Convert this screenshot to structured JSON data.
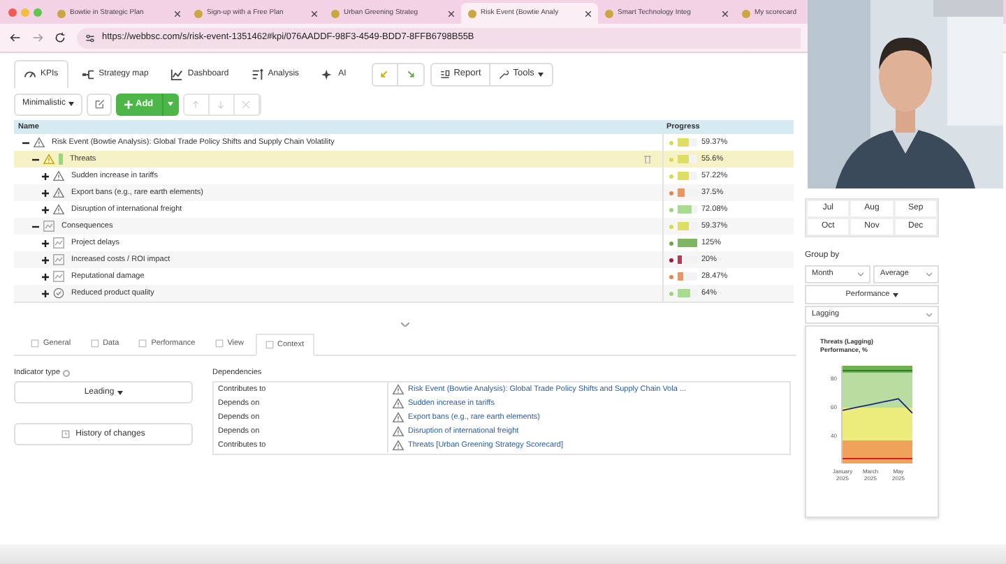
{
  "browser": {
    "tabs": [
      {
        "title": "Bowtie in Strategic Plan",
        "selected": false
      },
      {
        "title": "Sign-up with a Free Plan",
        "selected": false
      },
      {
        "title": "Urban Greening Strateg",
        "selected": false
      },
      {
        "title": "Risk Event (Bowtie Analy",
        "selected": true
      },
      {
        "title": "Smart Technology Integ",
        "selected": false
      },
      {
        "title": "My scorecard",
        "selected": false
      }
    ],
    "url": "https://webbsc.com/s/risk-event-1351462#kpi/076AADDF-98F3-4549-BDD7-8FFB6798B55B"
  },
  "toolbar": {
    "tabs": [
      {
        "label": "KPIs",
        "kind": "kpis",
        "selected": true
      },
      {
        "label": "Strategy map",
        "kind": "map",
        "selected": false
      },
      {
        "label": "Dashboard",
        "kind": "dashboard",
        "selected": false
      },
      {
        "label": "Analysis",
        "kind": "analysis",
        "selected": false
      },
      {
        "label": "AI",
        "kind": "ai",
        "selected": false
      }
    ],
    "report": "Report",
    "tools": "Tools"
  },
  "subtoolbar": {
    "view": "Minimalistic",
    "add": "Add"
  },
  "table": {
    "columns": [
      "Name",
      "Progress"
    ],
    "rows": [
      {
        "name": "Risk Event (Bowtie Analysis): Global Trade Policy Shifts and Supply Chain Volatility",
        "kind": "risk",
        "expanded": true,
        "selected": false,
        "progress": "59.37%",
        "level": 0.59,
        "color": "#d9d94a",
        "children": [
          {
            "name": "Threats",
            "kind": "threats",
            "expanded": true,
            "selected": true,
            "progress": "55.6%",
            "level": 0.56,
            "color": "#d9d94a",
            "children": [
              {
                "name": "Sudden increase in tariffs",
                "kind": "risk",
                "expanded": false,
                "selected": false,
                "progress": "57.22%",
                "level": 0.57,
                "color": "#d9d94a"
              },
              {
                "name": "Export bans (e.g., rare earth elements)",
                "kind": "risk",
                "expanded": false,
                "selected": false,
                "progress": "37.5%",
                "level": 0.38,
                "color": "#e8844a"
              },
              {
                "name": "Disruption of international freight",
                "kind": "risk",
                "expanded": false,
                "selected": false,
                "progress": "72.08%",
                "level": 0.72,
                "color": "#9ad67e"
              }
            ]
          },
          {
            "name": "Consequences",
            "kind": "consequence",
            "expanded": true,
            "selected": false,
            "progress": "59.37%",
            "level": 0.59,
            "color": "#d9d94a",
            "children": [
              {
                "name": "Project delays",
                "kind": "consequence",
                "expanded": false,
                "selected": false,
                "progress": "125%",
                "level": 1,
                "color": "#6aaa4a"
              },
              {
                "name": "Increased costs / ROI impact",
                "kind": "consequence",
                "expanded": false,
                "selected": false,
                "progress": "20%",
                "level": 0.2,
                "color": "#a01c3c"
              },
              {
                "name": "Reputational damage",
                "kind": "consequence",
                "expanded": false,
                "selected": false,
                "progress": "28.47%",
                "level": 0.28,
                "color": "#e8844a"
              },
              {
                "name": "Reduced product quality",
                "kind": "objective",
                "expanded": false,
                "selected": false,
                "progress": "64%",
                "level": 0.64,
                "color": "#9ad67e"
              }
            ]
          }
        ]
      }
    ]
  },
  "detail_tabs": [
    {
      "label": "General",
      "selected": false
    },
    {
      "label": "Data",
      "selected": false
    },
    {
      "label": "Performance",
      "selected": false
    },
    {
      "label": "View",
      "selected": false
    },
    {
      "label": "Context",
      "selected": true
    }
  ],
  "indicator_type": {
    "label": "Indicator type",
    "value": "Leading"
  },
  "history_button": "History of changes",
  "dependencies": {
    "title": "Dependencies",
    "rows": [
      {
        "relation": "Contributes to",
        "target": "Risk Event (Bowtie Analysis): Global Trade Policy Shifts and Supply Chain Vola ..."
      },
      {
        "relation": "Depends on",
        "target": "Sudden increase in tariffs"
      },
      {
        "relation": "Depends on",
        "target": "Export bans (e.g., rare earth elements)"
      },
      {
        "relation": "Depends on",
        "target": "Disruption of international freight"
      },
      {
        "relation": "Contributes to",
        "target": "Threats [Urban Greening Strategy Scorecard]"
      }
    ]
  },
  "right_panel": {
    "months": [
      "Jul",
      "Aug",
      "Sep",
      "Oct",
      "Nov",
      "Dec"
    ],
    "group_by": "Group by",
    "period": "Month",
    "aggregate": "Average",
    "performance": "Performance",
    "indicator": "Lagging",
    "chart_title": "Threats (Lagging)",
    "chart_subtitle": "Performance, %",
    "chart_data": {
      "type": "line",
      "categories": [
        "January 2025",
        null,
        "March 2025",
        null,
        "May 2025",
        null
      ],
      "yticks": [
        40,
        60,
        80
      ],
      "ylim": [
        21,
        89
      ],
      "series": [
        {
          "color": "#1a2a7a",
          "values": [
            58,
            60,
            62,
            64,
            66,
            56
          ]
        }
      ]
    }
  }
}
